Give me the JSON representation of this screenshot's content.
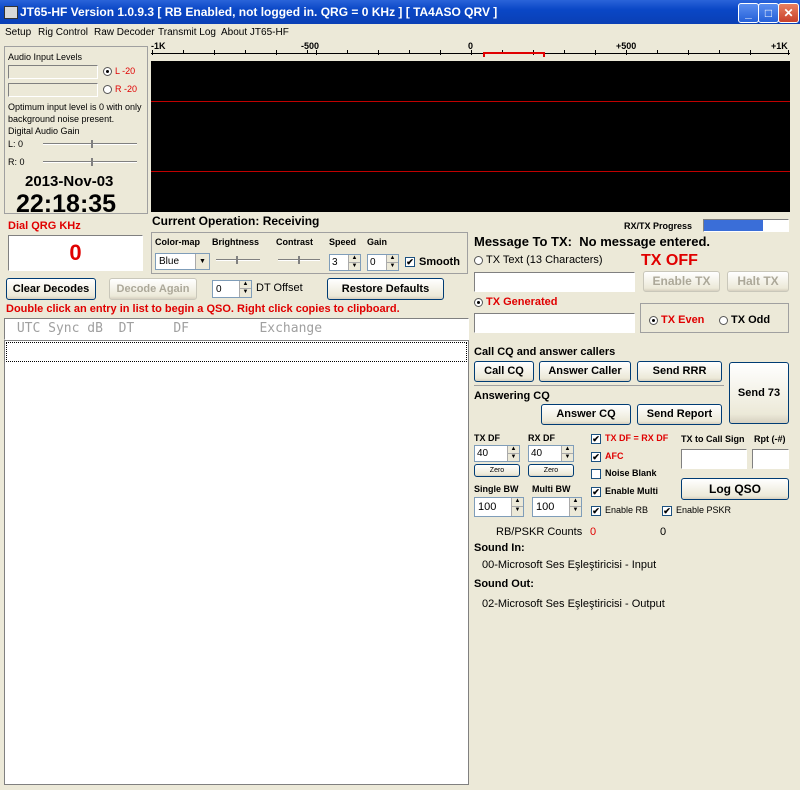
{
  "window": {
    "title": "JT65-HF Version 1.0.9.3  [ RB Enabled, not logged in.  QRG = 0 KHz ] [ TA4ASO QRV ]",
    "minimize": "_",
    "maximize": "□",
    "close": "✕"
  },
  "menu": [
    "Setup",
    "Rig Control",
    "Raw Decoder",
    "Transmit Log",
    "About JT65-HF"
  ],
  "audio": {
    "title": "Audio Input Levels",
    "left": "L -20",
    "right": "R -20",
    "note": "Optimum input level is 0 with only background noise present.",
    "gain_title": "Digital Audio Gain",
    "l_gain": "L: 0",
    "r_gain": "R: 0"
  },
  "clock": {
    "date": "2013-Nov-03",
    "time": "22:18:35"
  },
  "dial": {
    "label": "Dial QRG KHz",
    "value": "0"
  },
  "ruler": {
    "m1k": "-1K",
    "m500": "-500",
    "zero": "0",
    "p500": "+500",
    "p1k": "+1K"
  },
  "current_op": {
    "label": "Current Operation:",
    "value": "Receiving"
  },
  "progress": {
    "label": "RX/TX Progress",
    "fraction": 0.7
  },
  "controls": {
    "colormap_label": "Color-map",
    "colormap_value": "Blue",
    "brightness_label": "Brightness",
    "contrast_label": "Contrast",
    "speed_label": "Speed",
    "speed_value": "3",
    "gain_label": "Gain",
    "gain_value": "0",
    "smooth_label": "Smooth",
    "smooth_checked": "✔"
  },
  "decode": {
    "clear": "Clear Decodes",
    "again": "Decode Again",
    "dt_value": "0",
    "dt_label": "DT Offset",
    "restore": "Restore Defaults",
    "hint": "Double click an entry in list to begin a QSO.  Right click copies to clipboard.",
    "header": " UTC Sync dB  DT     DF         Exchange"
  },
  "tx": {
    "message_label": "Message To TX:",
    "message_value": "No message entered.",
    "tx_text_label": "TX Text (13 Characters)",
    "tx_off": "TX OFF",
    "enable_tx": "Enable TX",
    "halt_tx": "Halt TX",
    "tx_generated": "TX Generated",
    "tx_even": "TX Even",
    "tx_odd": "TX Odd"
  },
  "qso": {
    "cq_section": "Call CQ and answer callers",
    "call_cq": "Call CQ",
    "answer_caller": "Answer Caller",
    "send_rrr": "Send RRR",
    "send_73": "Send 73",
    "answering_cq": "Answering CQ",
    "answer_cq": "Answer CQ",
    "send_report": "Send Report"
  },
  "df": {
    "tx_df_label": "TX DF",
    "tx_df_value": "40",
    "rx_df_label": "RX DF",
    "rx_df_value": "40",
    "zero": "Zero",
    "txdf_eq_rxdf": "TX DF = RX DF",
    "afc": "AFC",
    "noise_blank": "Noise Blank",
    "tx_to_call_label": "TX to Call Sign",
    "rpt_label": "Rpt (-#)",
    "single_bw_label": "Single BW",
    "single_bw_value": "100",
    "multi_bw_label": "Multi BW",
    "multi_bw_value": "100",
    "enable_multi": "Enable Multi",
    "log_qso": "Log QSO",
    "enable_rb": "Enable RB",
    "enable_pskr": "Enable PSKR",
    "check": "✔"
  },
  "counts": {
    "label": "RB/PSKR Counts",
    "rb": "0",
    "pskr": "0"
  },
  "sound": {
    "in_label": "Sound In:",
    "in_device": "00-Microsoft Ses Eşleştiricisi - Input",
    "out_label": "Sound Out:",
    "out_device": "02-Microsoft Ses Eşleştiricisi - Output"
  },
  "colors": {
    "waterfall_bg": "#000000",
    "waterfall_line": "#c00000",
    "accent_red": "#e00000",
    "progress_fill": "#3a6ed8"
  }
}
